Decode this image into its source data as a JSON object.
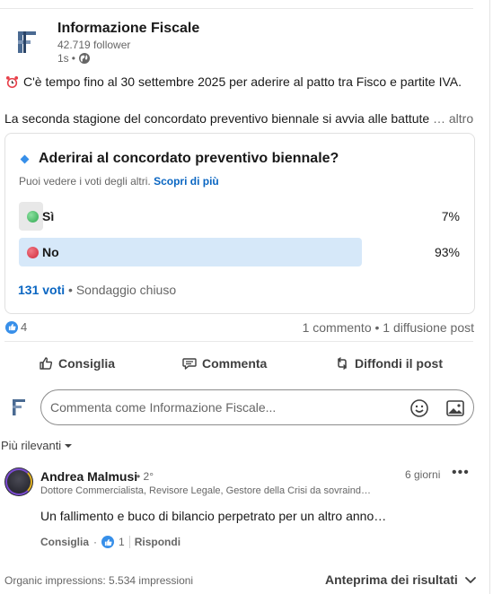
{
  "post": {
    "company_name": "Informazione Fiscale",
    "followers": "42.719 follower",
    "age": "1s",
    "line1": "C'è tempo fino al 30 settembre 2025 per aderire al patto tra Fisco e partite IVA.",
    "line2": "La seconda stagione del concordato preventivo biennale si avvia alle battute",
    "more": "… altro"
  },
  "poll": {
    "question": "Aderirai al concordato preventivo biennale?",
    "hint": "Puoi vedere i voti degli altri.",
    "hint_link": "Scopri di più",
    "options": [
      {
        "label": "Sì",
        "percent": "7%",
        "share": 0.07
      },
      {
        "label": "No",
        "percent": "93%",
        "share": 0.93
      }
    ],
    "votes": "131 voti",
    "status": "• Sondaggio chiuso"
  },
  "social": {
    "reaction_count": "4",
    "summary": "1 commento • 1 diffusione post"
  },
  "actions": {
    "like": "Consiglia",
    "comment": "Commenta",
    "repost": "Diffondi il post"
  },
  "comment_box": {
    "placeholder": "Commenta come Informazione Fiscale..."
  },
  "sort": {
    "label": "Più rilevanti"
  },
  "comment": {
    "author": "Andrea Malmusi",
    "degree": "• 2°",
    "time": "6 giorni",
    "headline": "Dottore Commercialista, Revisore Legale, Gestore della Crisi da sovraind…",
    "text": "Un fallimento e buco di bilancio perpetrato per un altro anno…",
    "like_label": "Consiglia",
    "dot": "·",
    "like_count": "1",
    "reply_label": "Rispondi"
  },
  "footer": {
    "impressions": "Organic impressions: 5.534 impressioni",
    "preview": "Anteprima dei risultati"
  },
  "colors": {
    "accent": "#0a66c2",
    "poll_bar": "#d6e8f9",
    "green_dot": "#2fa84f",
    "red_dot": "#d1293a"
  },
  "icons": [
    "logo-icon",
    "globe-icon",
    "alarm-clock-icon",
    "diamond-icon",
    "like-icon",
    "comment-icon",
    "repost-icon",
    "emoji-icon",
    "image-icon",
    "chevron-down-icon",
    "more-icon"
  ]
}
